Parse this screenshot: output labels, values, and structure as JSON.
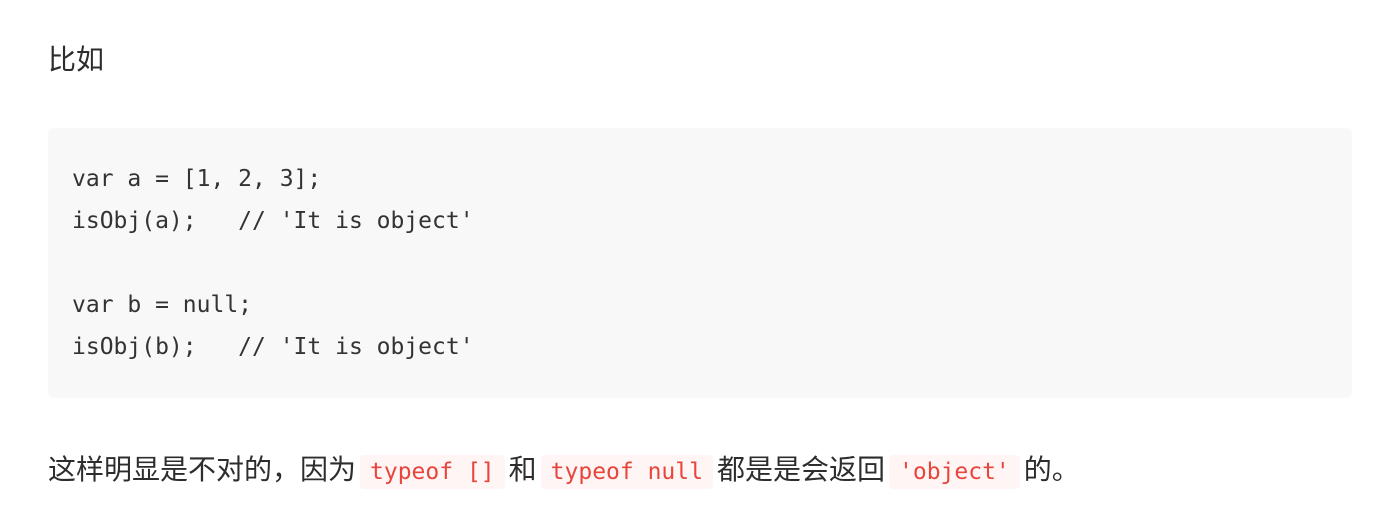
{
  "intro_text": "比如",
  "code_block": {
    "lines": [
      "var a = [1, 2, 3];",
      "isObj(a);   // 'It is object'",
      "",
      "var b = null;",
      "isObj(b);   // 'It is object'"
    ]
  },
  "explanation": {
    "part1": "这样明显是不对的，因为",
    "code1": "typeof []",
    "part2": "和",
    "code2": "typeof null",
    "part3": "都是是会返回",
    "code3": "'object'",
    "part4": "的。"
  },
  "colors": {
    "code_background": "#f8f8f8",
    "inline_code_text": "#e8453c",
    "inline_code_background": "#fff5f5",
    "body_text": "#2d2d2d"
  }
}
